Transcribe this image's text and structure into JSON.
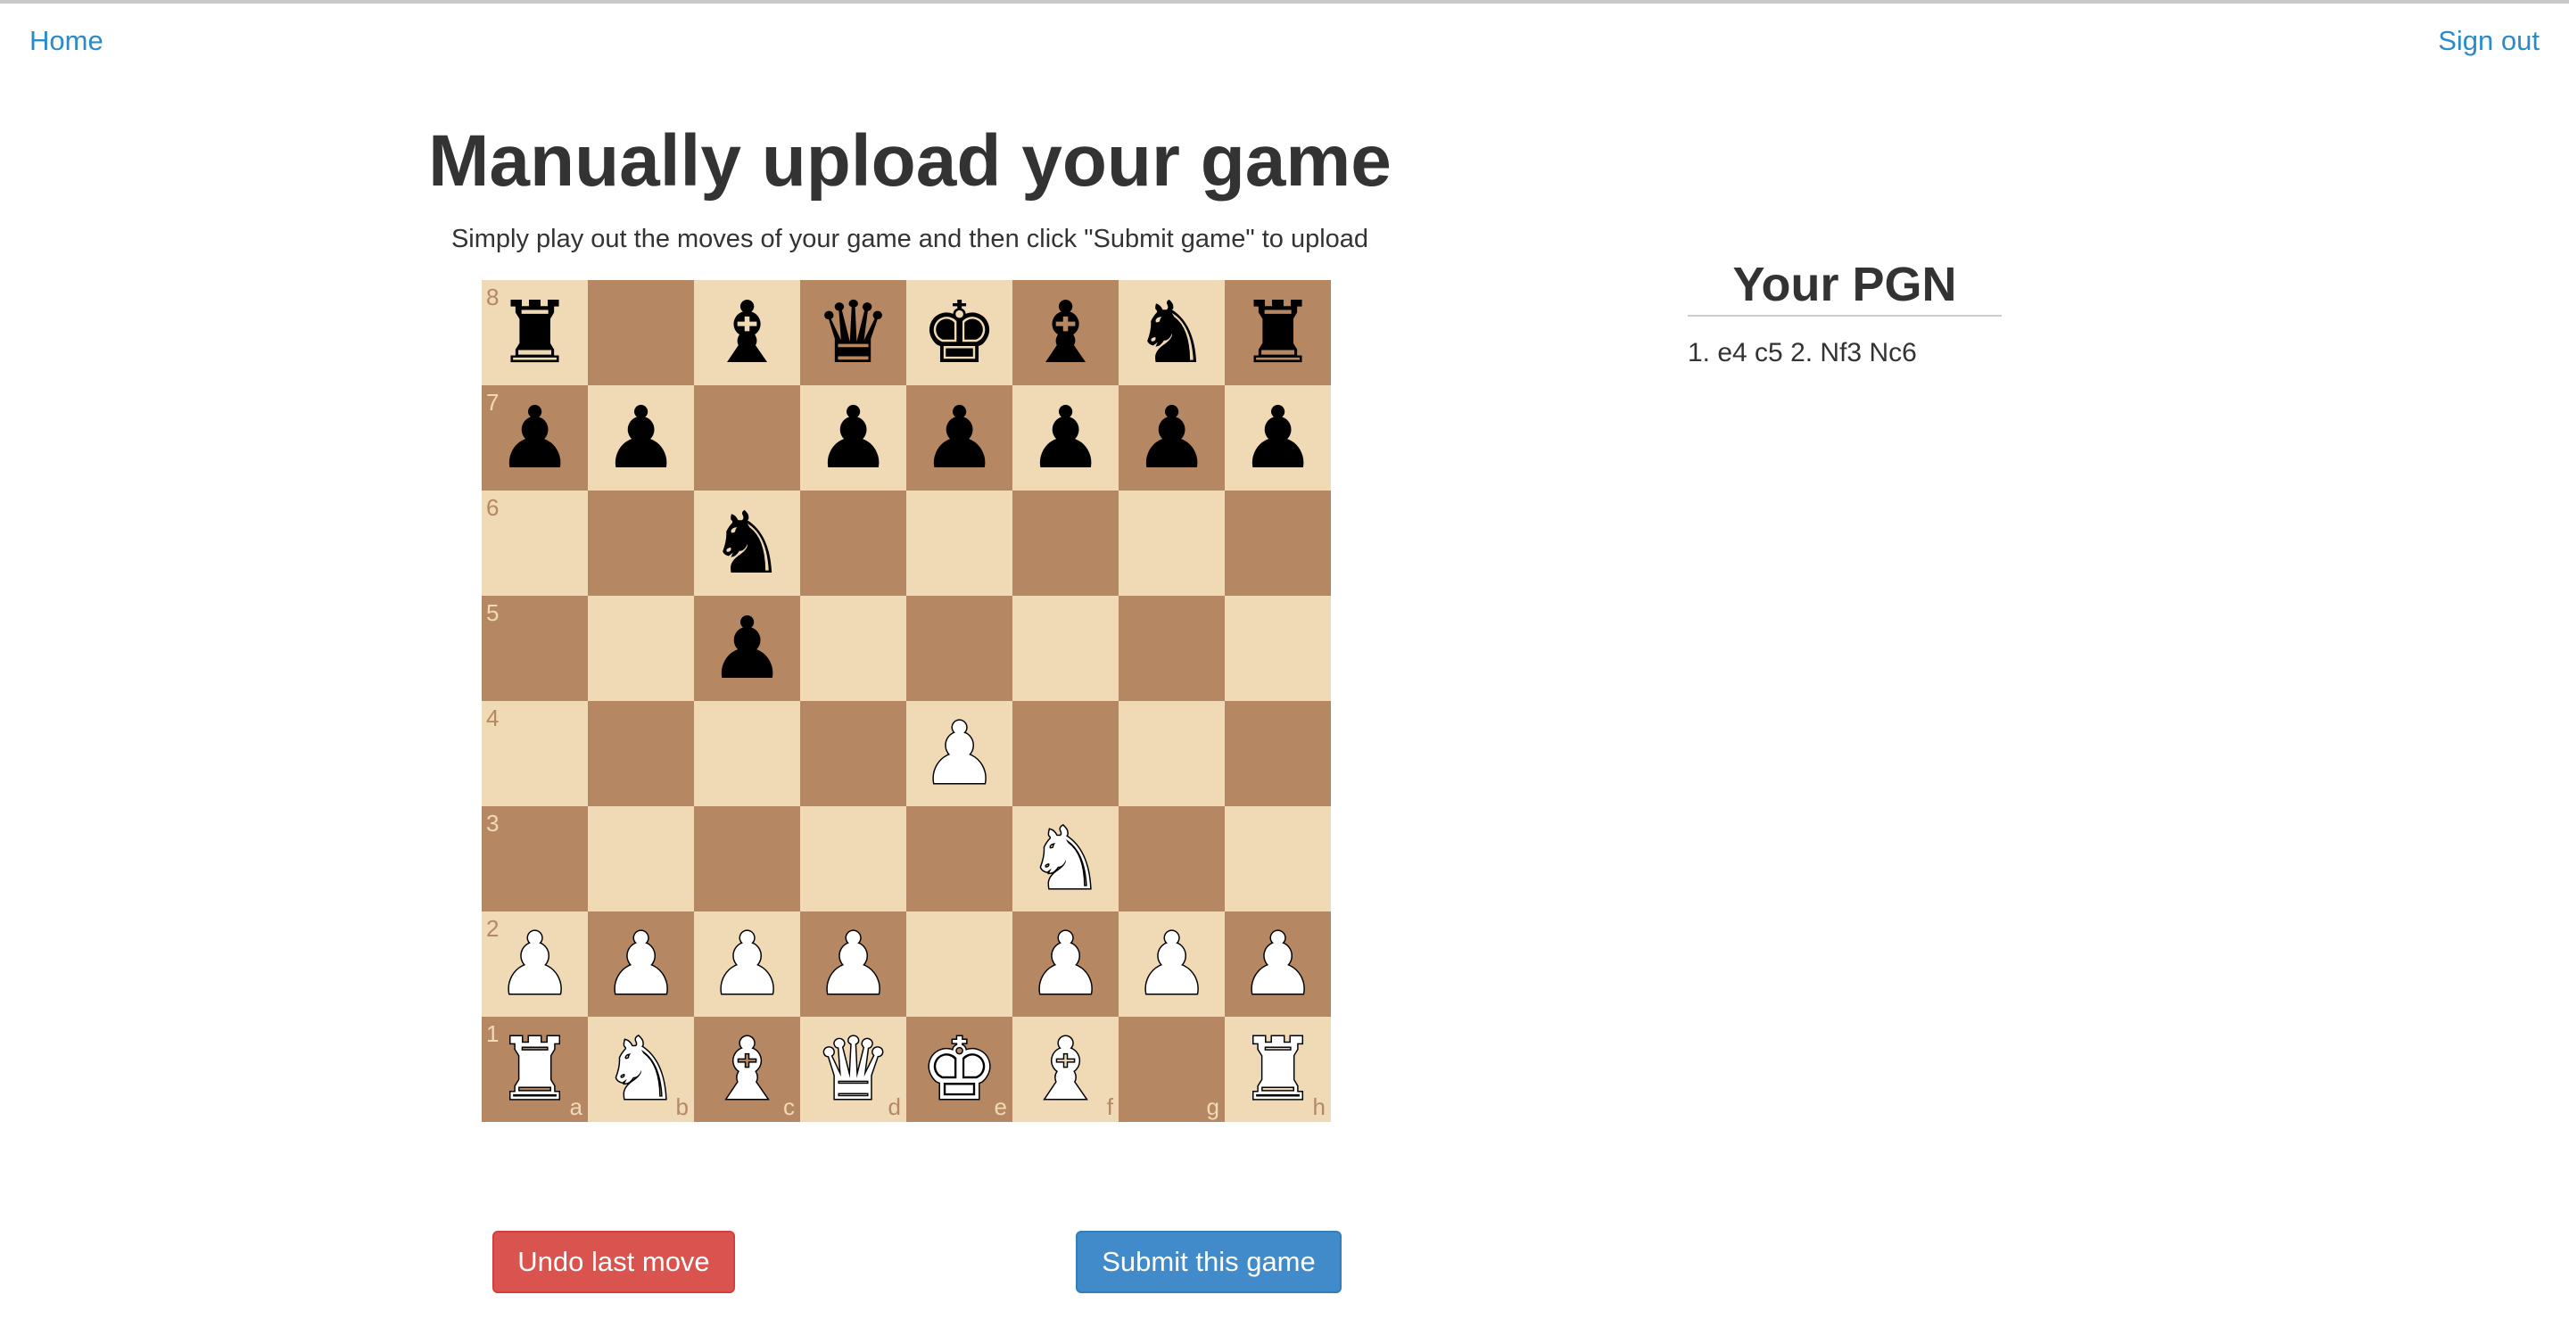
{
  "nav": {
    "home_label": "Home",
    "signout_label": "Sign out"
  },
  "page": {
    "title": "Manually upload your game",
    "subtitle": "Simply play out the moves of your game and then click \"Submit game\" to upload"
  },
  "board": {
    "files": [
      "a",
      "b",
      "c",
      "d",
      "e",
      "f",
      "g",
      "h"
    ],
    "ranks": [
      "8",
      "7",
      "6",
      "5",
      "4",
      "3",
      "2",
      "1"
    ],
    "colors": {
      "light": "#f0d9b5",
      "dark": "#b58863"
    },
    "rows": [
      [
        "br",
        "",
        "bb",
        "bq",
        "bk",
        "bb",
        "bn",
        "br"
      ],
      [
        "bp",
        "bp",
        "",
        "bp",
        "bp",
        "bp",
        "bp",
        "bp"
      ],
      [
        "",
        "",
        "bn",
        "",
        "",
        "",
        "",
        ""
      ],
      [
        "",
        "",
        "bp",
        "",
        "",
        "",
        "",
        ""
      ],
      [
        "",
        "",
        "",
        "",
        "wp",
        "",
        "",
        ""
      ],
      [
        "",
        "",
        "",
        "",
        "",
        "wn",
        "",
        ""
      ],
      [
        "wp",
        "wp",
        "wp",
        "wp",
        "",
        "wp",
        "wp",
        "wp"
      ],
      [
        "wr",
        "wn",
        "wb",
        "wq",
        "wk",
        "wb",
        "",
        "wr"
      ]
    ]
  },
  "pgn": {
    "title": "Your PGN",
    "moves": "1. e4 c5 2. Nf3 Nc6"
  },
  "buttons": {
    "undo_label": "Undo last move",
    "submit_label": "Submit this game",
    "undo_color": "#d9534f",
    "submit_color": "#428bca"
  }
}
